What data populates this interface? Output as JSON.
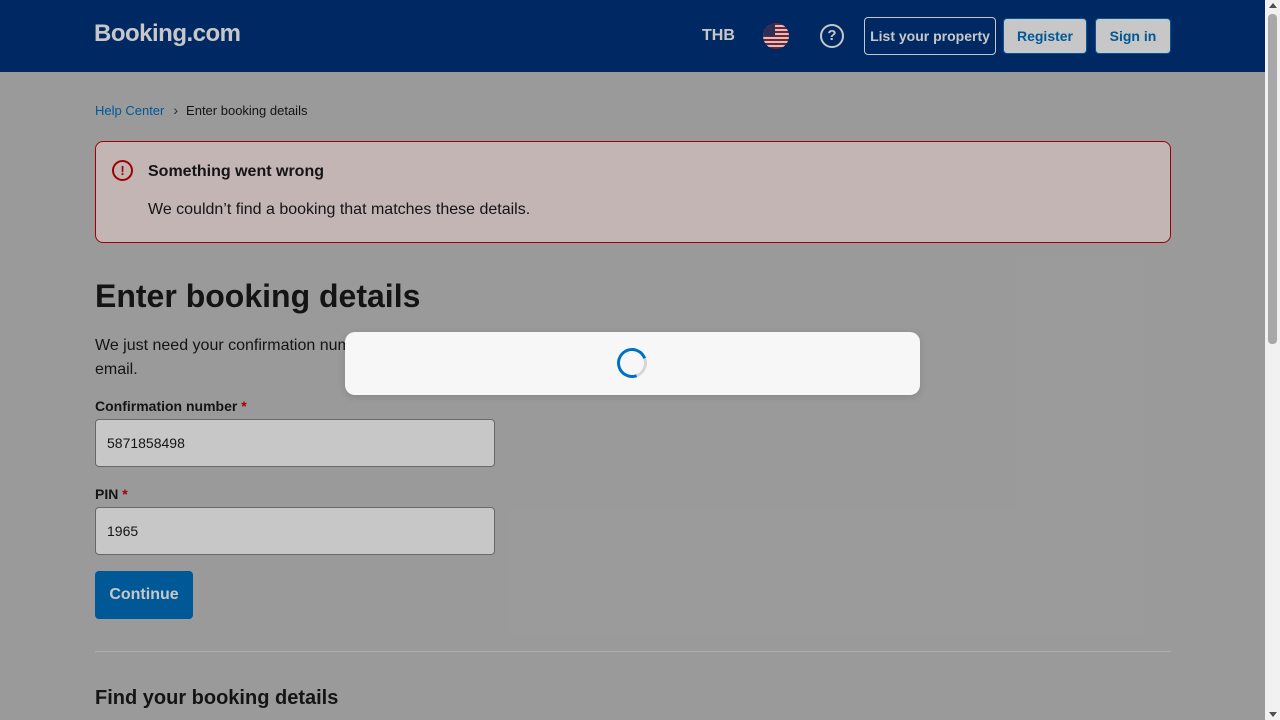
{
  "header": {
    "logo": "Booking.com",
    "currency": "THB",
    "help_glyph": "?",
    "list_property": "List your property",
    "register": "Register",
    "sign_in": "Sign in"
  },
  "breadcrumb": {
    "home": "Help Center",
    "separator": "›",
    "current": "Enter booking details"
  },
  "alert": {
    "icon_glyph": "!",
    "title": "Something went wrong",
    "message": "We couldn’t find a booking that matches these details."
  },
  "form": {
    "title": "Enter booking details",
    "intro": "We just need your confirmation number and PIN. You’ll find them at the top of your confirmation email.",
    "confirmation_label": "Confirmation number",
    "confirmation_value": "5871858498",
    "pin_label": "PIN",
    "pin_value": "1965",
    "required_mark": "*",
    "continue_label": "Continue"
  },
  "find_section": {
    "title": "Find your booking details"
  },
  "colors": {
    "brand": "#003580",
    "accent": "#0071c2",
    "error": "#cc0000"
  },
  "icons": {
    "help": "question-circle-icon",
    "alert": "error-circle-icon",
    "flag": "us-flag-icon",
    "spinner": "loading-spinner-icon"
  }
}
